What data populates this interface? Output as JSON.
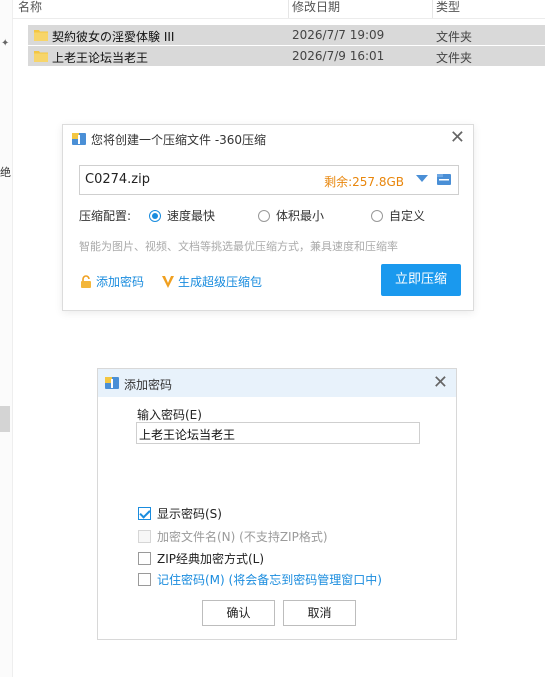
{
  "explorer": {
    "columns": {
      "name": "名称",
      "date": "修改日期",
      "type": "类型"
    },
    "rows": [
      {
        "name": "契約彼女の淫愛体験 III",
        "date": "2026/7/7 19:09",
        "type": "文件夹"
      },
      {
        "name": "上老王论坛当老王",
        "date": "2026/7/9 16:01",
        "type": "文件夹"
      }
    ],
    "left_strip_char": "绝",
    "pin_glyph": "✦"
  },
  "zip_dialog": {
    "title": "您将创建一个压缩文件 -360压缩",
    "close": "✕",
    "filename": "C0274.zip",
    "space": "剩余:257.8GB",
    "config_label": "压缩配置:",
    "options": [
      "速度最快",
      "体积最小",
      "自定义"
    ],
    "selected_option": "速度最快",
    "hint": "智能为图片、视频、文档等挑选最优压缩方式，兼具速度和压缩率",
    "add_password": "添加密码",
    "super_pkg": "生成超级压缩包",
    "compress_button": "立即压缩"
  },
  "password_dialog": {
    "title": "添加密码",
    "close": "✕",
    "input_label": "输入密码(E)",
    "password_value": "上老王论坛当老王",
    "options": [
      {
        "label": "显示密码(S)",
        "checked": true,
        "disabled": false
      },
      {
        "label": "加密文件名(N) (不支持ZIP格式)",
        "checked": false,
        "disabled": true
      },
      {
        "label": "ZIP经典加密方式(L)",
        "checked": false,
        "disabled": false
      },
      {
        "label": "记住密码(M) (将会备忘到密码管理窗口中)",
        "checked": false,
        "disabled": false
      }
    ],
    "ok_button": "确认",
    "cancel_button": "取消"
  },
  "colors": {
    "accent": "#1a99ee",
    "link": "#1a8cde",
    "space_orange": "#e8860c",
    "folder_yellow": "#f3c642",
    "selected_row": "#d9d9d9"
  },
  "icons": {
    "folder": "folder-icon",
    "zip_logo": "360-zip-icon",
    "close": "close-icon",
    "dropdown": "chevron-down-icon",
    "browse": "folder-browse-icon",
    "lock": "lock-icon",
    "super_v": "v-icon"
  }
}
